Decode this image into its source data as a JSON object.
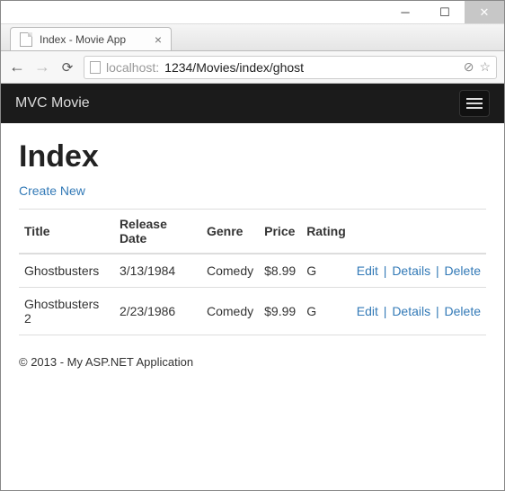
{
  "window": {
    "tab_title": "Index - Movie App",
    "url_host": "localhost:",
    "url_path": "1234/Movies/index/ghost"
  },
  "navbar": {
    "brand": "MVC Movie"
  },
  "page": {
    "heading": "Index",
    "create_label": "Create New"
  },
  "table": {
    "headers": {
      "title": "Title",
      "release": "Release Date",
      "genre": "Genre",
      "price": "Price",
      "rating": "Rating"
    },
    "rows": [
      {
        "title": "Ghostbusters",
        "release": "3/13/1984",
        "genre": "Comedy",
        "price": "$8.99",
        "rating": "G"
      },
      {
        "title": "Ghostbusters 2",
        "release": "2/23/1986",
        "genre": "Comedy",
        "price": "$9.99",
        "rating": "G"
      }
    ],
    "actions": {
      "edit": "Edit",
      "details": "Details",
      "delete": "Delete"
    }
  },
  "footer": {
    "text": "© 2013 - My ASP.NET Application"
  }
}
